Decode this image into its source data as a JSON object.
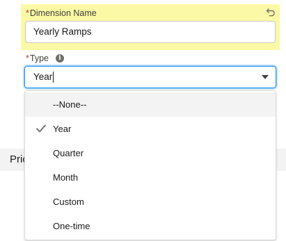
{
  "dimension_name": {
    "label": "Dimension Name",
    "required_marker": "*",
    "value": "Yearly Ramps"
  },
  "type_field": {
    "label": "Type",
    "required_marker": "*",
    "info_icon": "i",
    "value": "Year"
  },
  "background": {
    "partial_tab_text": "Pric"
  },
  "dropdown": {
    "selected": "Year",
    "options": [
      {
        "label": "--None--"
      },
      {
        "label": "Year"
      },
      {
        "label": "Quarter"
      },
      {
        "label": "Month"
      },
      {
        "label": "Custom"
      },
      {
        "label": "One-time"
      }
    ]
  },
  "icons": {
    "undo": "undo-icon",
    "info": "info-icon",
    "chevron": "chevron-down-icon",
    "check": "check-icon"
  },
  "colors": {
    "edited_highlight": "#fbf9a5",
    "focus_border": "#1b96ff",
    "required": "#c23934",
    "hover": "#f3f3f3"
  }
}
